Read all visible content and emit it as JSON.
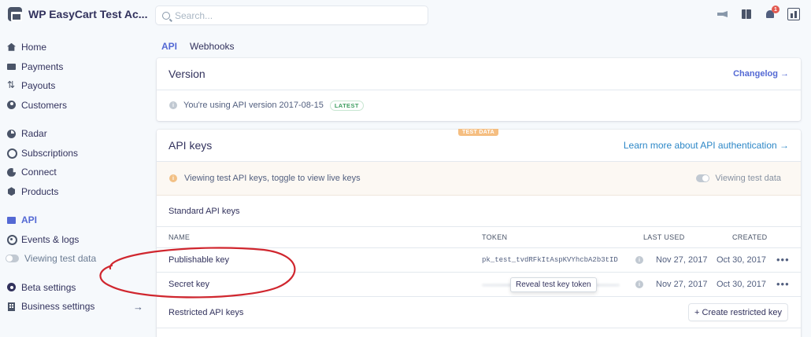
{
  "account": {
    "name": "WP EasyCart Test Ac...",
    "chevron": "⌄"
  },
  "search": {
    "placeholder": "Search..."
  },
  "notifications": {
    "count": "1"
  },
  "sidebar": {
    "groups": [
      [
        {
          "label": "Home",
          "icon": "home-icon"
        },
        {
          "label": "Payments",
          "icon": "payments-icon"
        },
        {
          "label": "Payouts",
          "icon": "payouts-icon"
        },
        {
          "label": "Customers",
          "icon": "customers-icon"
        }
      ],
      [
        {
          "label": "Radar",
          "icon": "radar-icon"
        },
        {
          "label": "Subscriptions",
          "icon": "subscriptions-icon"
        },
        {
          "label": "Connect",
          "icon": "connect-icon"
        },
        {
          "label": "Products",
          "icon": "products-icon"
        }
      ],
      [
        {
          "label": "API",
          "icon": "api-icon",
          "active": true
        },
        {
          "label": "Events & logs",
          "icon": "events-icon"
        },
        {
          "label": "Viewing test data",
          "icon": "toggle"
        }
      ],
      [
        {
          "label": "Beta settings",
          "icon": "gear-icon"
        },
        {
          "label": "Business settings",
          "icon": "building-icon",
          "arrow": "→"
        }
      ]
    ]
  },
  "tabs": [
    {
      "label": "API",
      "active": true
    },
    {
      "label": "Webhooks"
    }
  ],
  "version_card": {
    "title": "Version",
    "link": "Changelog →",
    "message": "You're using API version 2017-08-15",
    "badge": "LATEST"
  },
  "keys_card": {
    "test_badge": "TEST DATA",
    "title": "API keys",
    "link": "Learn more about API authentication →",
    "notice": "Viewing test API keys, toggle to view live keys",
    "toggle_label": "Viewing test data",
    "standard_label": "Standard API keys",
    "columns": {
      "name": "NAME",
      "token": "TOKEN",
      "last_used": "LAST USED",
      "created": "CREATED"
    },
    "rows": [
      {
        "name": "Publishable key",
        "token": "pk_test_tvdRFkItAspKVYhcbA2b3tID",
        "last_used": "Nov 27, 2017",
        "created": "Oct 30, 2017"
      },
      {
        "name": "Secret key",
        "token": "",
        "tooltip": "Reveal test key token",
        "last_used": "Nov 27, 2017",
        "created": "Oct 30, 2017"
      }
    ],
    "restricted_label": "Restricted API keys",
    "create_button": "+ Create restricted key"
  },
  "colors": {
    "accent": "#5469d4",
    "link": "#2c87c7",
    "annotation": "#d0262e",
    "test_badge": "#f5be81"
  }
}
